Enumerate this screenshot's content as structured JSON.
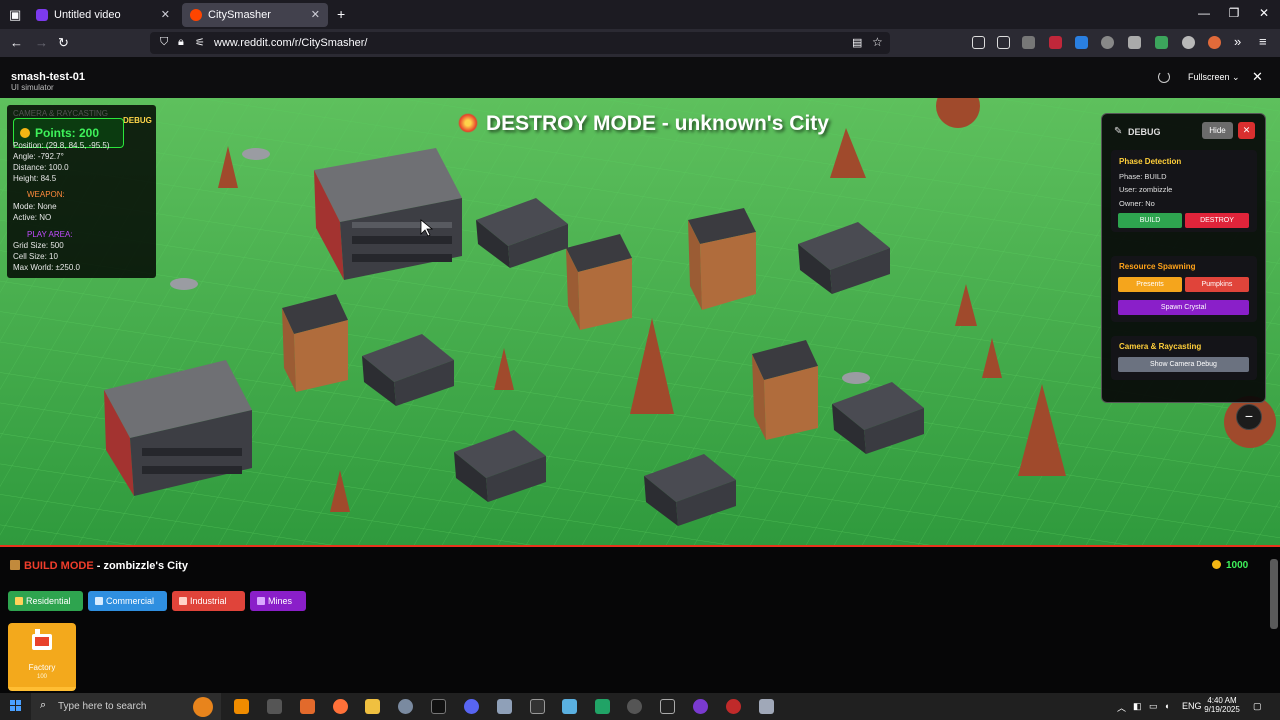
{
  "browser": {
    "tabs": [
      {
        "title": "Untitled video",
        "favicon_color": "#7c3aed",
        "active": false
      },
      {
        "title": "CitySmasher",
        "favicon_color": "#ff4500",
        "active": true
      }
    ],
    "new_tab": "+",
    "url": "www.reddit.com/r/CitySmasher/"
  },
  "app": {
    "title": "smash-test-01",
    "subtitle": "UI simulator",
    "fullscreen_label": "Fullscreen ⌄",
    "close": "✕"
  },
  "scene": {
    "banner": "DESTROY MODE - unknown's City"
  },
  "stats": {
    "faded_header": "CAMERA & RAYCASTING",
    "debug_tag": "DEBUG",
    "points": "Points: 200",
    "lines": [
      "Position: (29.8, 84.5, -95.5)",
      "Angle: -792.7°",
      "Distance: 100.0",
      "Height: 84.5"
    ],
    "weapon_header": "WEAPON:",
    "weapon_lines": [
      "Mode: None",
      "Active: NO"
    ],
    "play_header": "PLAY AREA:",
    "play_lines": [
      "Grid Size: 500",
      "Cell Size: 10",
      "Max World: ±250.0"
    ]
  },
  "debug": {
    "title": "DEBUG",
    "hide": "Hide",
    "close": "✕",
    "phase": {
      "title": "Phase Detection",
      "lines": [
        "Phase: BUILD",
        "User: zombizzle",
        "Owner: No"
      ],
      "build": "BUILD",
      "destroy": "DESTROY"
    },
    "resource": {
      "title": "Resource Spawning",
      "presents": "Presents",
      "pumpkins": "Pumpkins",
      "crystal": "Spawn Crystal"
    },
    "camera": {
      "title": "Camera & Raycasting",
      "show": "Show Camera Debug"
    },
    "minimize": "−"
  },
  "build": {
    "mode_label": "BUILD MODE",
    "city": " - zombizzle's City",
    "coins": "1000",
    "categories": [
      {
        "label": "Residential",
        "color": "#2ea44f"
      },
      {
        "label": "Commercial",
        "color": "#2f8fe0"
      },
      {
        "label": "Industrial",
        "color": "#e0443a"
      },
      {
        "label": "Mines",
        "color": "#8a1fc9"
      }
    ],
    "card": {
      "label": "Factory",
      "cost": "100"
    }
  },
  "taskbar": {
    "search_placeholder": "Type here to search",
    "lang": "ENG",
    "time": "4:40 AM",
    "date": "9/19/2025"
  },
  "colors": {
    "grass": "#3fb14a",
    "accent_red": "#e8341c",
    "points_green": "#3ef25a"
  }
}
